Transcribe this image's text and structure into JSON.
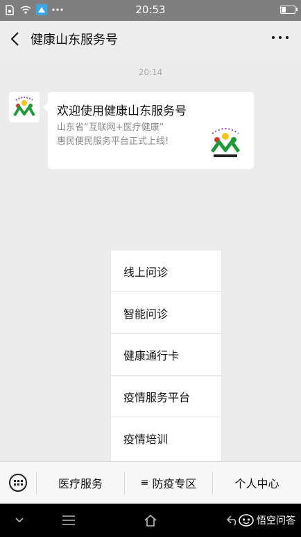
{
  "status_bar": {
    "time": "20:53",
    "battery_level": 0.3
  },
  "header": {
    "title": "健康山东服务号"
  },
  "chat": {
    "timestamp": "20:14",
    "message": {
      "title": "欢迎使用健康山东服务号",
      "desc_line1": "山东省“互联网+医疗健康”",
      "desc_line2": "惠民便民服务平台正式上线!"
    }
  },
  "popup_menu": {
    "items": [
      "线上问诊",
      "智能问诊",
      "健康通行卡",
      "疫情服务平台",
      "疫情培训"
    ]
  },
  "bottom_menu": {
    "tab1": "医疗服务",
    "tab2_icon": "≡",
    "tab2": "防疫专区",
    "tab3": "个人中心"
  },
  "watermark": {
    "text": "悟空问答"
  },
  "colors": {
    "logo_green": "#1e9a3a",
    "logo_yellow": "#f0c419",
    "logo_red": "#d23a2a",
    "logo_purple": "#8a4fb3"
  }
}
